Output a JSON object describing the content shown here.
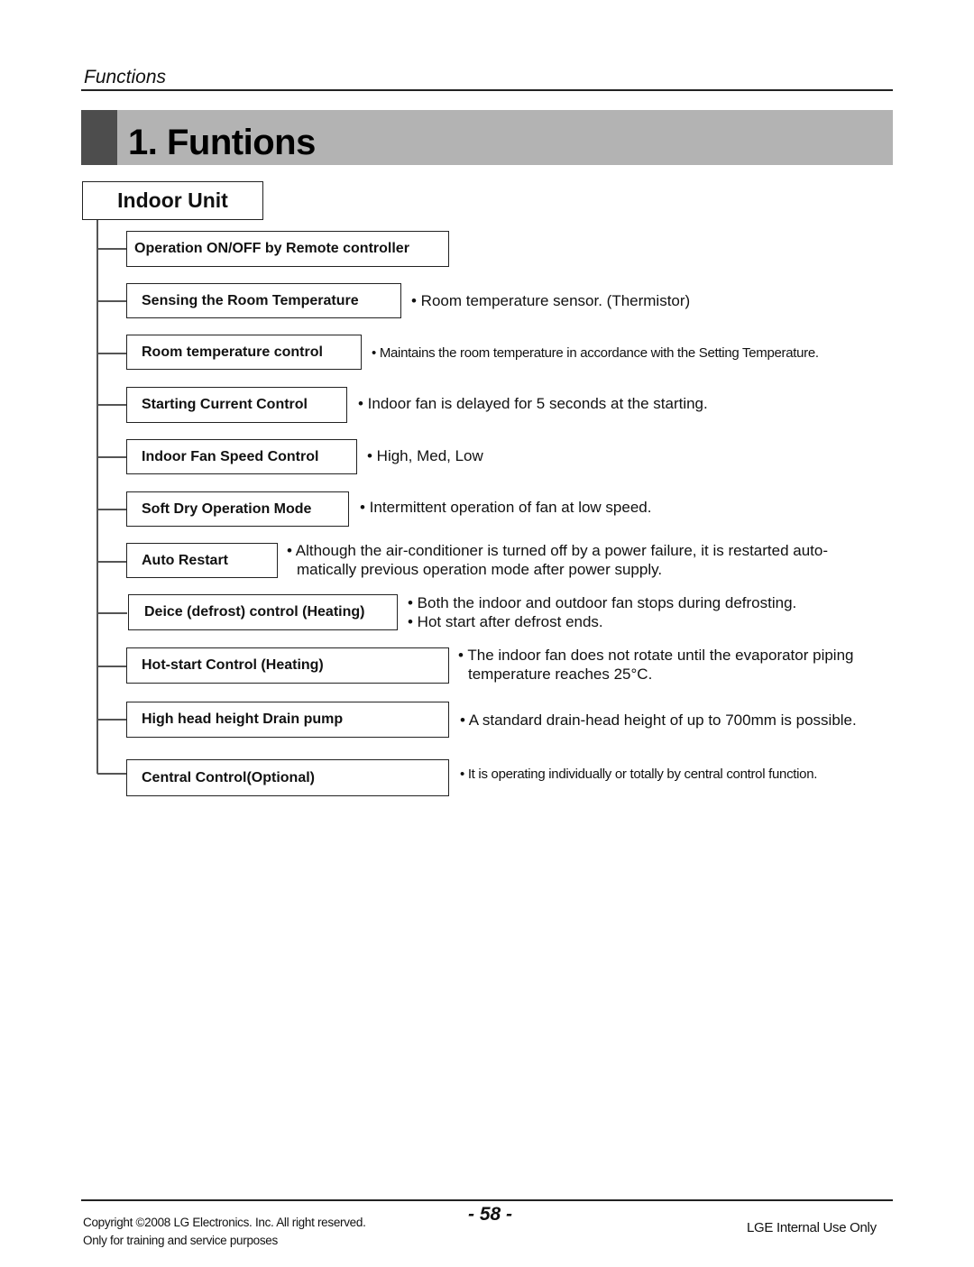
{
  "header": {
    "section_label": "Functions",
    "title": "1. Funtions"
  },
  "unit": {
    "label": "Indoor Unit"
  },
  "functions": [
    {
      "name": "Operation ON/OFF by Remote controller",
      "desc": []
    },
    {
      "name": "Sensing the Room Temperature",
      "desc": [
        "• Room temperature sensor. (Thermistor)"
      ]
    },
    {
      "name": "Room temperature control",
      "desc": [
        "• Maintains the room temperature in accordance with the Setting Temperature."
      ]
    },
    {
      "name": "Starting Current Control",
      "desc": [
        "• Indoor fan is delayed for 5 seconds at the starting."
      ]
    },
    {
      "name": "Indoor Fan Speed Control",
      "desc": [
        "• High, Med, Low"
      ]
    },
    {
      "name": "Soft Dry Operation Mode",
      "desc": [
        "• Intermittent operation of fan at low speed."
      ]
    },
    {
      "name": "Auto Restart",
      "desc": [
        "• Although the air-conditioner is turned off by a power failure, it is restarted auto-",
        "matically previous operation mode after power supply."
      ]
    },
    {
      "name": "Deice (defrost) control (Heating)",
      "desc": [
        "• Both the indoor and outdoor fan stops during defrosting.",
        "• Hot start after defrost ends."
      ]
    },
    {
      "name": "Hot-start Control (Heating)",
      "desc": [
        "• The indoor fan does not rotate until the evaporator piping",
        "temperature reaches 25°C."
      ]
    },
    {
      "name": "High head height Drain pump",
      "desc": [
        "• A standard drain-head height of up to 700mm is possible."
      ]
    },
    {
      "name": "Central Control(Optional)",
      "desc": [
        "• It is operating individually or totally by central control function."
      ]
    }
  ],
  "footer": {
    "copyright": "Copyright ©2008 LG Electronics. Inc. All right reserved.",
    "purpose": "Only for training and service purposes",
    "page_number": "- 58 -",
    "internal": "LGE Internal Use Only"
  }
}
